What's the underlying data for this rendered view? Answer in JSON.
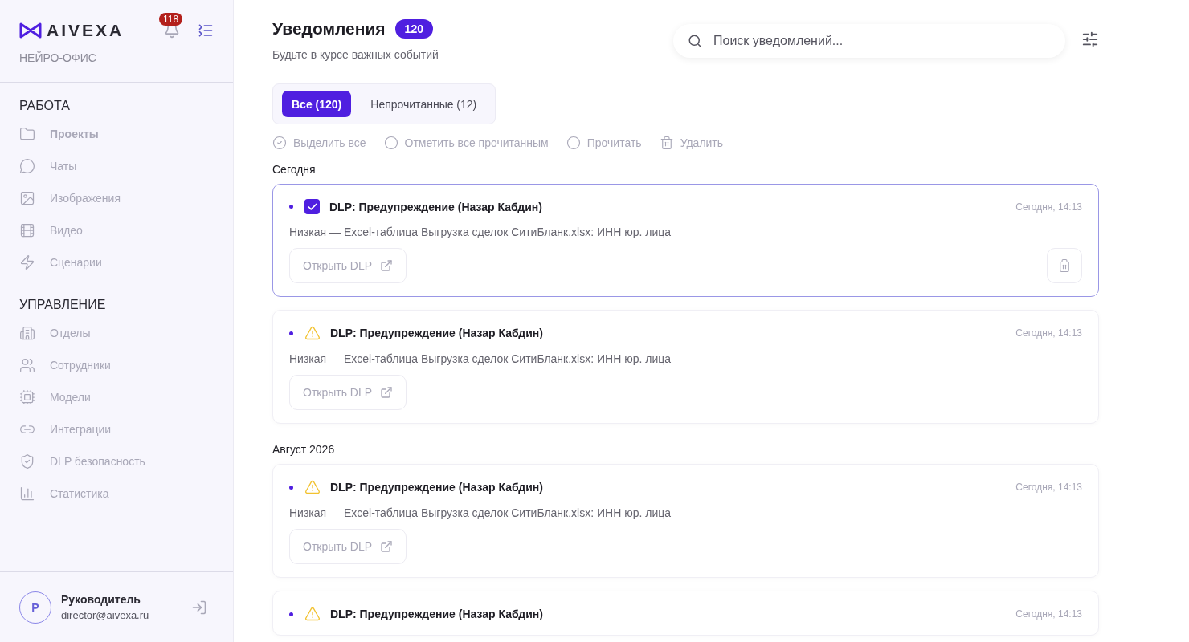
{
  "sidebar": {
    "logo": "AIVEXA",
    "notifications_badge": "118",
    "subtitle": "НЕЙРО-ОФИС",
    "sections": [
      {
        "title": "РАБОТА",
        "items": [
          {
            "label": "Проекты",
            "selected": true
          },
          {
            "label": "Чаты",
            "selected": false
          },
          {
            "label": "Изображения",
            "selected": false
          },
          {
            "label": "Видео",
            "selected": false
          },
          {
            "label": "Сценарии",
            "selected": false
          }
        ]
      },
      {
        "title": "УПРАВЛЕНИЕ",
        "items": [
          {
            "label": "Отделы",
            "selected": false
          },
          {
            "label": "Сотрудники",
            "selected": false
          },
          {
            "label": "Модели",
            "selected": false
          },
          {
            "label": "Интеграции",
            "selected": false
          },
          {
            "label": "DLP безопасность",
            "selected": false
          },
          {
            "label": "Статистика",
            "selected": false
          }
        ]
      }
    ],
    "user": {
      "initial": "Р",
      "name": "Руководитель",
      "email": "director@aivexa.ru"
    }
  },
  "header": {
    "title": "Уведомления",
    "count": "120",
    "subtitle": "Будьте в курсе важных событий",
    "search": {
      "placeholder": "Поиск уведомлений..."
    }
  },
  "tabs": [
    {
      "label": "Все (120)",
      "selected": true
    },
    {
      "label": "Непрочитанные (12)",
      "selected": false
    }
  ],
  "actions": [
    {
      "label": "Выделить все"
    },
    {
      "label": "Отметить все прочитанным"
    },
    {
      "label": "Прочитать"
    },
    {
      "label": "Удалить"
    }
  ],
  "groups": [
    {
      "title": "Сегодня",
      "items": [
        {
          "title": "DLP: Предупреждение (Назар Кабдин)",
          "time": "Сегодня, 14:13",
          "text": "Низкая — Excel-таблица Выгрузка сделок СитиБланк.xlsx: ИНН юр. лица",
          "button": "Открыть DLP",
          "unread": true,
          "selected": true
        },
        {
          "title": "DLP: Предупреждение (Назар Кабдин)",
          "time": "Сегодня, 14:13",
          "text": "Низкая — Excel-таблица Выгрузка сделок СитиБланк.xlsx: ИНН юр. лица",
          "button": "Открыть DLP",
          "unread": true,
          "selected": false
        }
      ]
    },
    {
      "title": "Август 2026",
      "items": [
        {
          "title": "DLP: Предупреждение (Назар Кабдин)",
          "time": "Сегодня, 14:13",
          "text": "Низкая — Excel-таблица Выгрузка сделок СитиБланк.xlsx: ИНН юр. лица",
          "button": "Открыть DLP",
          "unread": true,
          "selected": false
        },
        {
          "title": "DLP: Предупреждение (Назар Кабдин)",
          "time": "Сегодня, 14:13",
          "unread": true,
          "selected": false
        }
      ]
    }
  ]
}
